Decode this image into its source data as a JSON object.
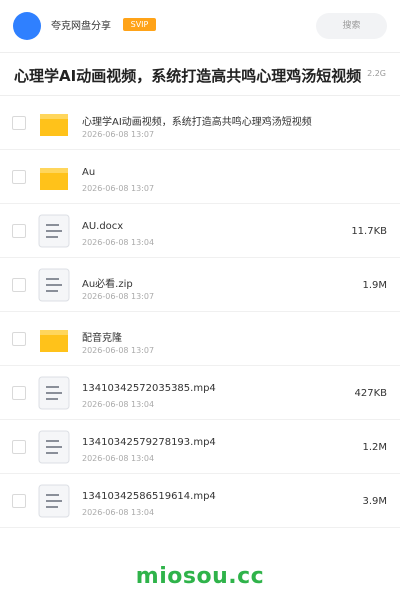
{
  "header": {
    "user_name": "夸克网盘分享",
    "badge": "SVIP",
    "search_label": "搜索"
  },
  "share": {
    "title": "心理学AI动画视频，系统打造高共鸣心理鸡汤短视频",
    "total_size": "2.2G"
  },
  "files": [
    {
      "type": "folder",
      "name": "心理学AI动画视频，系统打造高共鸣心理鸡汤短视频",
      "date": "2026-06-08 13:07",
      "size": ""
    },
    {
      "type": "folder",
      "name": "Au",
      "date": "2026-06-08 13:07",
      "size": ""
    },
    {
      "type": "file",
      "name": "AU.docx",
      "date": "2026-06-08 13:04",
      "size": "11.7KB"
    },
    {
      "type": "file",
      "name": "Au必看.zip",
      "date": "2026-06-08 13:07",
      "size": "1.9M"
    },
    {
      "type": "folder",
      "name": "配音克隆",
      "date": "2026-06-08 13:07",
      "size": ""
    },
    {
      "type": "file",
      "name": "13410342572035385.mp4",
      "date": "2026-06-08 13:04",
      "size": "427KB"
    },
    {
      "type": "file",
      "name": "13410342579278193.mp4",
      "date": "2026-06-08 13:04",
      "size": "1.2M"
    },
    {
      "type": "file",
      "name": "13410342586519614.mp4",
      "date": "2026-06-08 13:04",
      "size": "3.9M"
    }
  ],
  "footer": {
    "brand": "miosou.cc"
  },
  "colors": {
    "accent": "#2f80ff",
    "svip": "#ffa318",
    "folder": "#ffc21a",
    "brand_green": "#2fb34a"
  }
}
